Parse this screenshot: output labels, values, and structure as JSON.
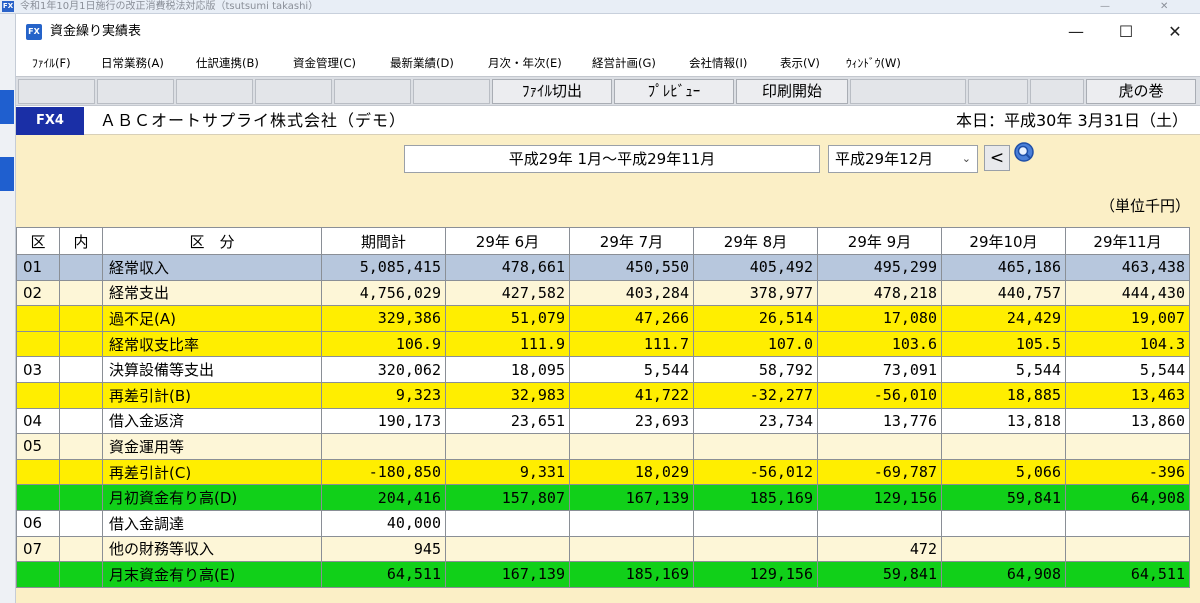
{
  "outer_window": {
    "title": "令和1年10月1日施行の改正消費税法対応版（tsutsumi takashi）",
    "icon_text": "FX"
  },
  "window": {
    "icon_text": "FX",
    "title": "資金繰り実績表",
    "minimize": "—",
    "maximize": "☐",
    "close": "✕"
  },
  "menu": [
    "ﾌｧｲﾙ(F)",
    "日常業務(A)",
    "仕訳連携(B)",
    "資金管理(C)",
    "最新業績(D)",
    "月次・年次(E)",
    "経営計画(G)",
    "会社情報(I)",
    "表示(V)",
    "ｳｨﾝﾄﾞｳ(W)"
  ],
  "toolbar": {
    "file_cut": "ﾌｧｲﾙ切出",
    "preview": "ﾌﾟﾚﾋﾞｭｰ",
    "print": "印刷開始",
    "tora": "虎の巻"
  },
  "company": {
    "badge": "FX4",
    "name": "ＡＢＣオートサプライ株式会社（デモ）",
    "today": "本日：平成30年 3月31日（土）"
  },
  "period": {
    "range": "平成29年 1月～平成29年11月",
    "month_selected": "平成29年12月",
    "prev": "<",
    "unit": "（単位千円）"
  },
  "colors": {
    "panel": "#fbefc6",
    "blue_row": "#b7c7dd",
    "yellow_row": "#ffee00",
    "green_row": "#11d019",
    "badge": "#1a2fa6"
  },
  "table": {
    "headers": [
      "区",
      "内",
      "区　分",
      "期間計",
      "29年 6月",
      "29年 7月",
      "29年 8月",
      "29年 9月",
      "29年10月",
      "29年11月"
    ],
    "rows": [
      {
        "style": "blue",
        "code": "01",
        "inner": "",
        "label": "経常収入",
        "values": [
          "5,085,415",
          "478,661",
          "450,550",
          "405,492",
          "495,299",
          "465,186",
          "463,438"
        ]
      },
      {
        "style": "cream",
        "code": "02",
        "inner": "",
        "label": "経常支出",
        "values": [
          "4,756,029",
          "427,582",
          "403,284",
          "378,977",
          "478,218",
          "440,757",
          "444,430"
        ]
      },
      {
        "style": "yellow",
        "code": "",
        "inner": "",
        "label": "過不足(A)",
        "values": [
          "329,386",
          "51,079",
          "47,266",
          "26,514",
          "17,080",
          "24,429",
          "19,007"
        ]
      },
      {
        "style": "yellow",
        "code": "",
        "inner": "",
        "label": "経常収支比率",
        "values": [
          "106.9",
          "111.9",
          "111.7",
          "107.0",
          "103.6",
          "105.5",
          "104.3"
        ]
      },
      {
        "style": "white",
        "code": "03",
        "inner": "",
        "label": "決算設備等支出",
        "values": [
          "320,062",
          "18,095",
          "5,544",
          "58,792",
          "73,091",
          "5,544",
          "5,544"
        ]
      },
      {
        "style": "yellow",
        "code": "",
        "inner": "",
        "label": "再差引計(B)",
        "values": [
          "9,323",
          "32,983",
          "41,722",
          "-32,277",
          "-56,010",
          "18,885",
          "13,463"
        ]
      },
      {
        "style": "white",
        "code": "04",
        "inner": "",
        "label": "借入金返済",
        "values": [
          "190,173",
          "23,651",
          "23,693",
          "23,734",
          "13,776",
          "13,818",
          "13,860"
        ]
      },
      {
        "style": "cream",
        "code": "05",
        "inner": "",
        "label": "資金運用等",
        "values": [
          "",
          "",
          "",
          "",
          "",
          "",
          ""
        ]
      },
      {
        "style": "yellow",
        "code": "",
        "inner": "",
        "label": "再差引計(C)",
        "values": [
          "-180,850",
          "9,331",
          "18,029",
          "-56,012",
          "-69,787",
          "5,066",
          "-396"
        ]
      },
      {
        "style": "green",
        "code": "",
        "inner": "",
        "label": "月初資金有り高(D)",
        "values": [
          "204,416",
          "157,807",
          "167,139",
          "185,169",
          "129,156",
          "59,841",
          "64,908"
        ]
      },
      {
        "style": "white",
        "code": "06",
        "inner": "",
        "label": "借入金調達",
        "values": [
          "40,000",
          "",
          "",
          "",
          "",
          "",
          ""
        ]
      },
      {
        "style": "cream",
        "code": "07",
        "inner": "",
        "label": "他の財務等収入",
        "values": [
          "945",
          "",
          "",
          "",
          "472",
          "",
          ""
        ]
      },
      {
        "style": "green",
        "code": "",
        "inner": "",
        "label": "月末資金有り高(E)",
        "values": [
          "64,511",
          "167,139",
          "185,169",
          "129,156",
          "59,841",
          "64,908",
          "64,511"
        ]
      }
    ]
  }
}
